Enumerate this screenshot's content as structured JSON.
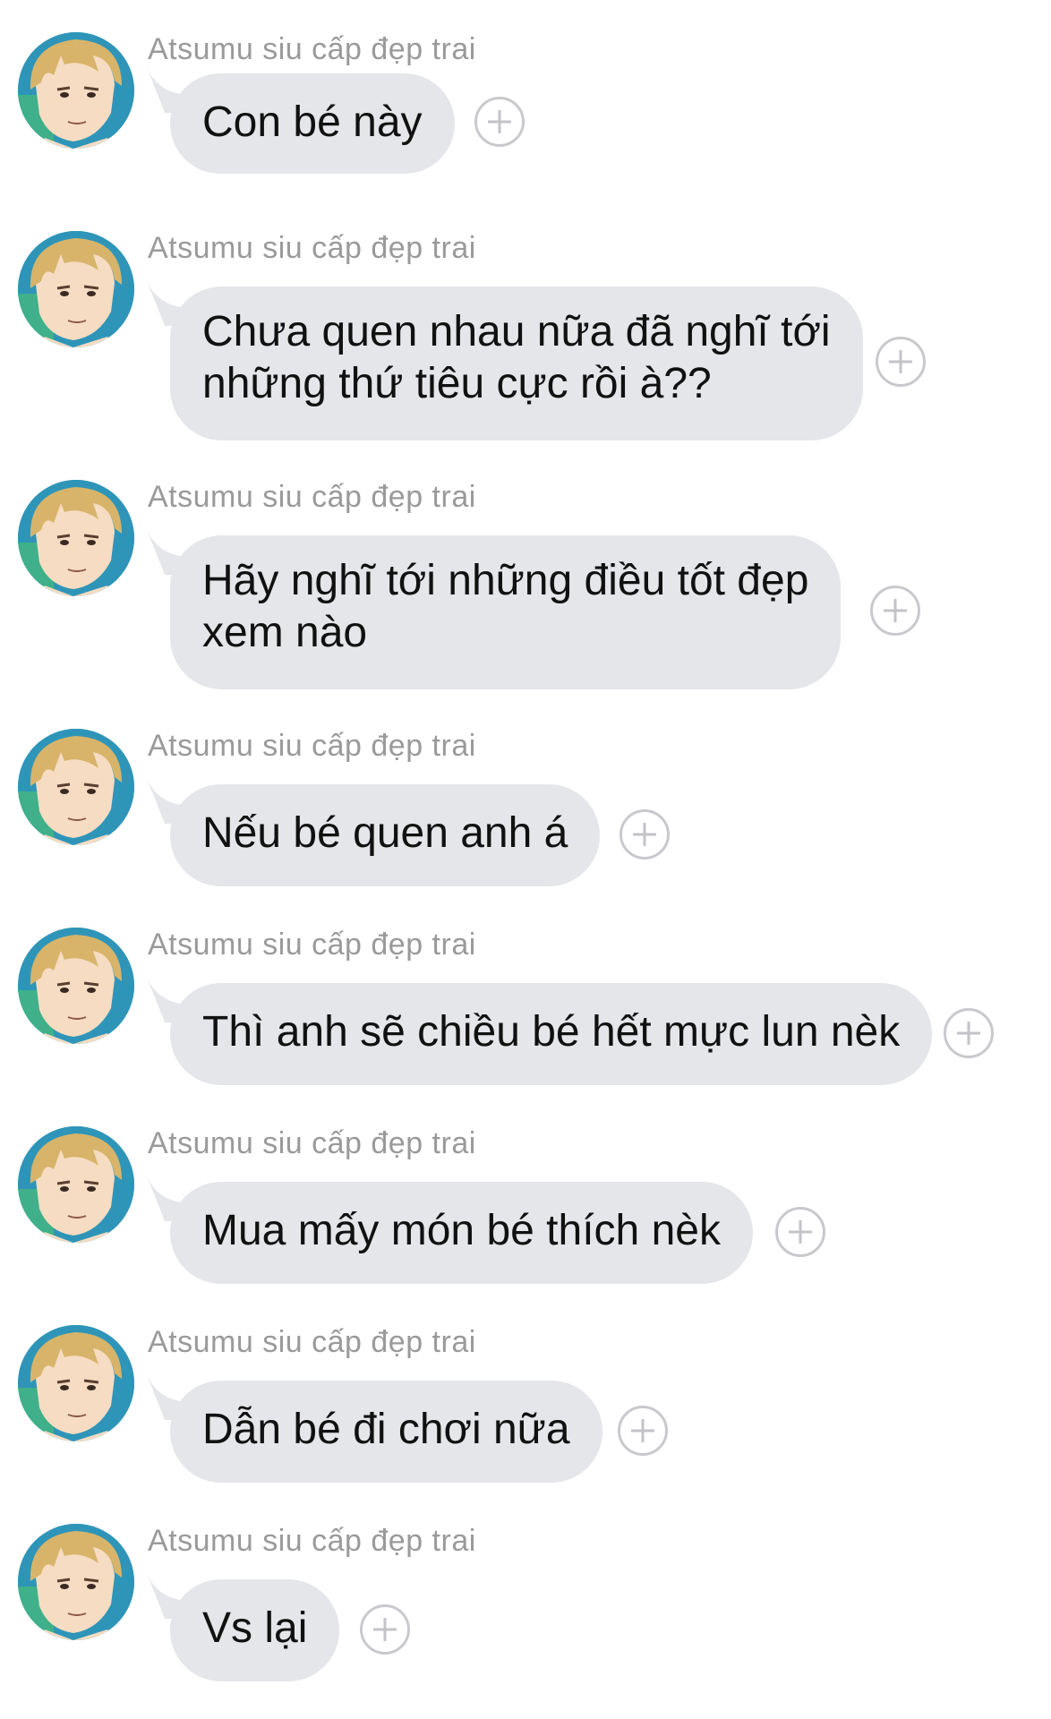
{
  "conversation": {
    "messages": [
      {
        "sender": "Atsumu siu cấp đẹp trai",
        "text": "Con bé này",
        "avatar_icon": "user-avatar",
        "reaction_icon": "add-reaction-icon"
      },
      {
        "sender": "Atsumu siu cấp đẹp trai",
        "text": "Chưa quen nhau nữa đã nghĩ tới\nnhững thứ tiêu cực rồi à??",
        "avatar_icon": "user-avatar",
        "reaction_icon": "add-reaction-icon"
      },
      {
        "sender": "Atsumu siu cấp đẹp trai",
        "text": "Hãy nghĩ tới những điều tốt đẹp\nxem nào",
        "avatar_icon": "user-avatar",
        "reaction_icon": "add-reaction-icon"
      },
      {
        "sender": "Atsumu siu cấp đẹp trai",
        "text": "Nếu bé quen anh á",
        "avatar_icon": "user-avatar",
        "reaction_icon": "add-reaction-icon"
      },
      {
        "sender": "Atsumu siu cấp đẹp trai",
        "text": "Thì anh sẽ chiều bé hết mực lun nèk",
        "avatar_icon": "user-avatar",
        "reaction_icon": "add-reaction-icon"
      },
      {
        "sender": "Atsumu siu cấp đẹp trai",
        "text": "Mua mấy món bé thích nèk",
        "avatar_icon": "user-avatar",
        "reaction_icon": "add-reaction-icon"
      },
      {
        "sender": "Atsumu siu cấp đẹp trai",
        "text": "Dẫn bé đi chơi nữa",
        "avatar_icon": "user-avatar",
        "reaction_icon": "add-reaction-icon"
      },
      {
        "sender": "Atsumu siu cấp đẹp trai",
        "text": "Vs lại",
        "avatar_icon": "user-avatar",
        "reaction_icon": "add-reaction-icon"
      }
    ]
  },
  "colors": {
    "bubble": "#e5e6e9",
    "sender_name": "#9a9a9a",
    "message_text": "#111111",
    "reaction_outline": "#c9c9cd"
  }
}
